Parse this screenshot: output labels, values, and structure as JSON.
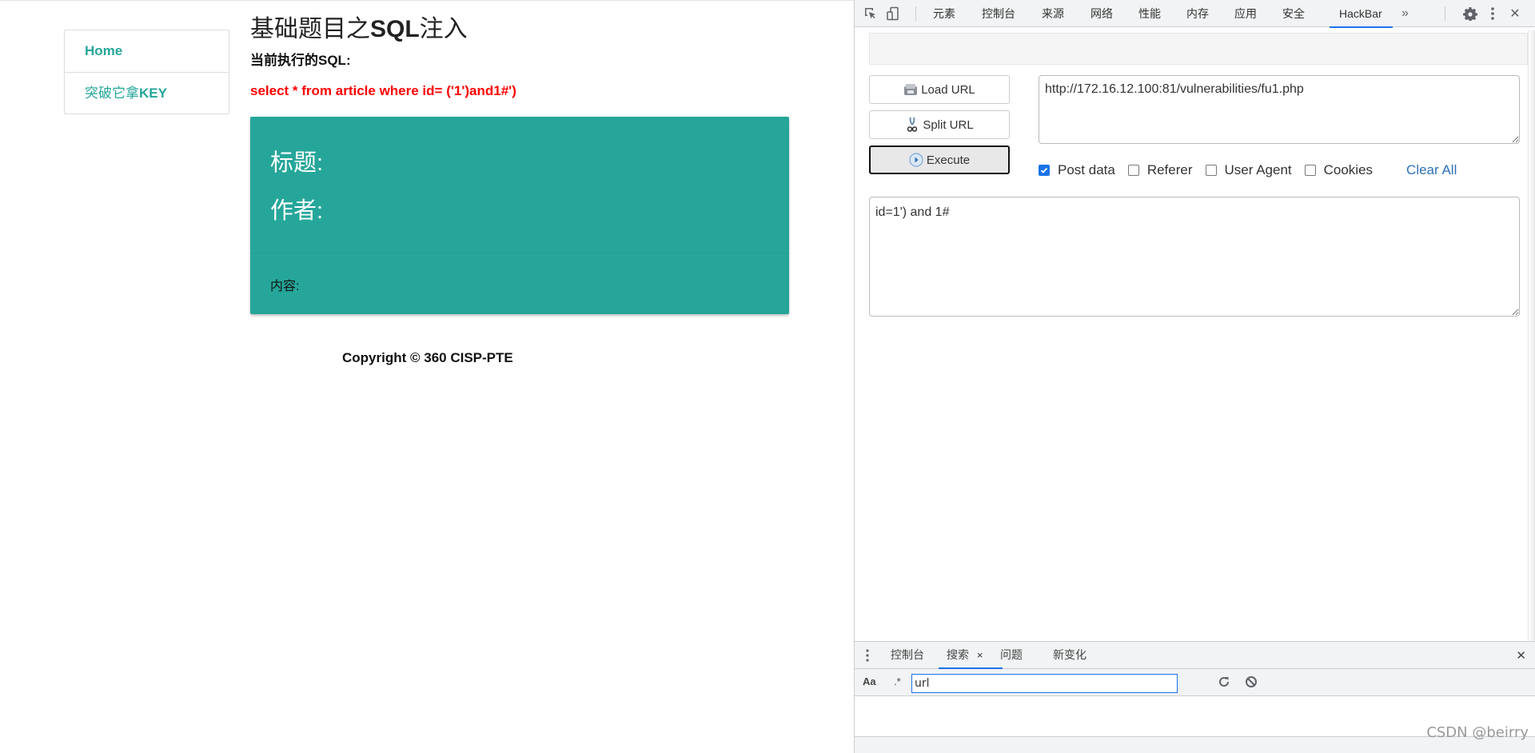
{
  "page": {
    "sidebar": {
      "items": [
        {
          "label": "Home"
        },
        {
          "label_cn": "突破它拿",
          "label_en": "KEY"
        }
      ]
    },
    "title_cn_prefix": "基础题目之",
    "title_bold": "SQL",
    "title_cn_suffix": "注入",
    "sql_label": "当前执行的SQL:",
    "sql_text": "select * from article where id= ('1')and1#')",
    "card": {
      "title_label": "标题:",
      "author_label": "作者:",
      "content_label": "内容:"
    },
    "copyright": "Copyright © 360 CISP-PTE"
  },
  "devtools": {
    "tabs": [
      {
        "label": "元素"
      },
      {
        "label": "控制台"
      },
      {
        "label": "来源"
      },
      {
        "label": "网络"
      },
      {
        "label": "性能"
      },
      {
        "label": "内存"
      },
      {
        "label": "应用"
      },
      {
        "label": "安全"
      },
      {
        "label": "HackBar",
        "active": true
      }
    ],
    "more_tabs_glyph": "»",
    "close_glyph": "✕",
    "hackbar": {
      "load_url_label": "Load URL",
      "split_url_label": "Split URL",
      "execute_label": "Execute",
      "url_value": "http://172.16.12.100:81/vulnerabilities/fu1.php",
      "options": [
        {
          "label": "Post data",
          "checked": true
        },
        {
          "label": "Referer",
          "checked": false
        },
        {
          "label": "User Agent",
          "checked": false
        },
        {
          "label": "Cookies",
          "checked": false
        }
      ],
      "clear_all_label": "Clear All",
      "post_data_value": "id=1') and 1#"
    },
    "drawer": {
      "tabs": [
        {
          "label": "控制台"
        },
        {
          "label": "搜索",
          "active": true,
          "closable": true
        },
        {
          "label": "问题"
        },
        {
          "label": "新变化"
        }
      ],
      "tab_close_glyph": "×",
      "close_glyph": "✕",
      "match_case_label": "Aa",
      "regex_label": ".*",
      "search_value": "url"
    }
  },
  "watermark": "CSDN @beirry",
  "colors": {
    "accent_teal": "#26a69a",
    "sql_red": "#ff0000",
    "devtools_blue": "#1a73e8",
    "clear_all_blue": "#2c6fb8"
  }
}
